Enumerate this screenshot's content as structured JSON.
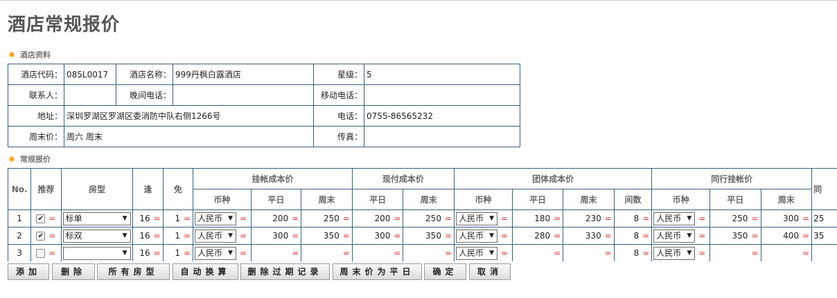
{
  "page_title": "酒店常规报价",
  "sections": {
    "hotel_info": "酒店资料",
    "regular_quote": "常规报价"
  },
  "hotel": {
    "code_label": "酒店代码：",
    "code": "085L0017",
    "name_label": "酒店名称：",
    "name": "999丹枫白露酒店",
    "star_label": "星级：",
    "star": "5",
    "contact_label": "联系人：",
    "contact": "",
    "night_phone_label": "晚间电话：",
    "night_phone": "",
    "mobile_label": "移动电话：",
    "mobile": "",
    "address_label": "地址：",
    "address": "深圳罗湖区罗湖区委消防中队右侧1266号",
    "phone_label": "电话：",
    "phone": "0755-86565232",
    "weekend_label": "周末价：",
    "weekend": "周六 周末",
    "fax_label": "传真：",
    "fax": ""
  },
  "price_table": {
    "headers": {
      "no": "No.",
      "recommend": "推荐",
      "room_type": "房型",
      "child": "逢",
      "free": "免",
      "listed_cost": "挂帐成本价",
      "cash_cost": "现付成本价",
      "group_cost": "团体成本价",
      "peer_listed": "同行挂帐价",
      "peer_cut": "同",
      "currency": "币种",
      "weekday": "平日",
      "weekend": "周末",
      "rooms": "间数"
    },
    "eq": "=",
    "rows": [
      {
        "no": "1",
        "checked": "✔",
        "room": "标单",
        "feng": "16",
        "mian": "1",
        "cur1": "人民币",
        "l_wd": "200",
        "l_we": "250",
        "c_wd": "200",
        "c_we": "250",
        "cur2": "人民币",
        "g_wd": "180",
        "g_we": "230",
        "g_rooms": "8",
        "cur3": "人民币",
        "p_wd": "250",
        "p_we": "300",
        "p_cut": "25"
      },
      {
        "no": "2",
        "checked": "✔",
        "room": "标双",
        "feng": "16",
        "mian": "1",
        "cur1": "人民币",
        "l_wd": "300",
        "l_we": "350",
        "c_wd": "300",
        "c_we": "350",
        "cur2": "人民币",
        "g_wd": "280",
        "g_we": "330",
        "g_rooms": "8",
        "cur3": "人民币",
        "p_wd": "350",
        "p_we": "400",
        "p_cut": "35"
      },
      {
        "no": "3",
        "checked": "",
        "room": "",
        "feng": "16",
        "mian": "1",
        "cur1": "人民币",
        "l_wd": "",
        "l_we": "",
        "c_wd": "",
        "c_we": "",
        "cur2": "人民币",
        "g_wd": "",
        "g_we": "",
        "g_rooms": "8",
        "cur3": "人民币",
        "p_wd": "",
        "p_we": "",
        "p_cut": ""
      }
    ]
  },
  "buttons": {
    "add": "添加",
    "delete": "删除",
    "all_rooms": "所有房型",
    "auto_convert": "自动换算",
    "delete_expired": "删除过期记录",
    "weekend_as_weekday": "周末价为平日",
    "confirm": "确定",
    "cancel": "取消"
  },
  "colors": {
    "border": "#3a5f80",
    "eq_sign": "#d03030",
    "bullet": "#f0a020"
  }
}
